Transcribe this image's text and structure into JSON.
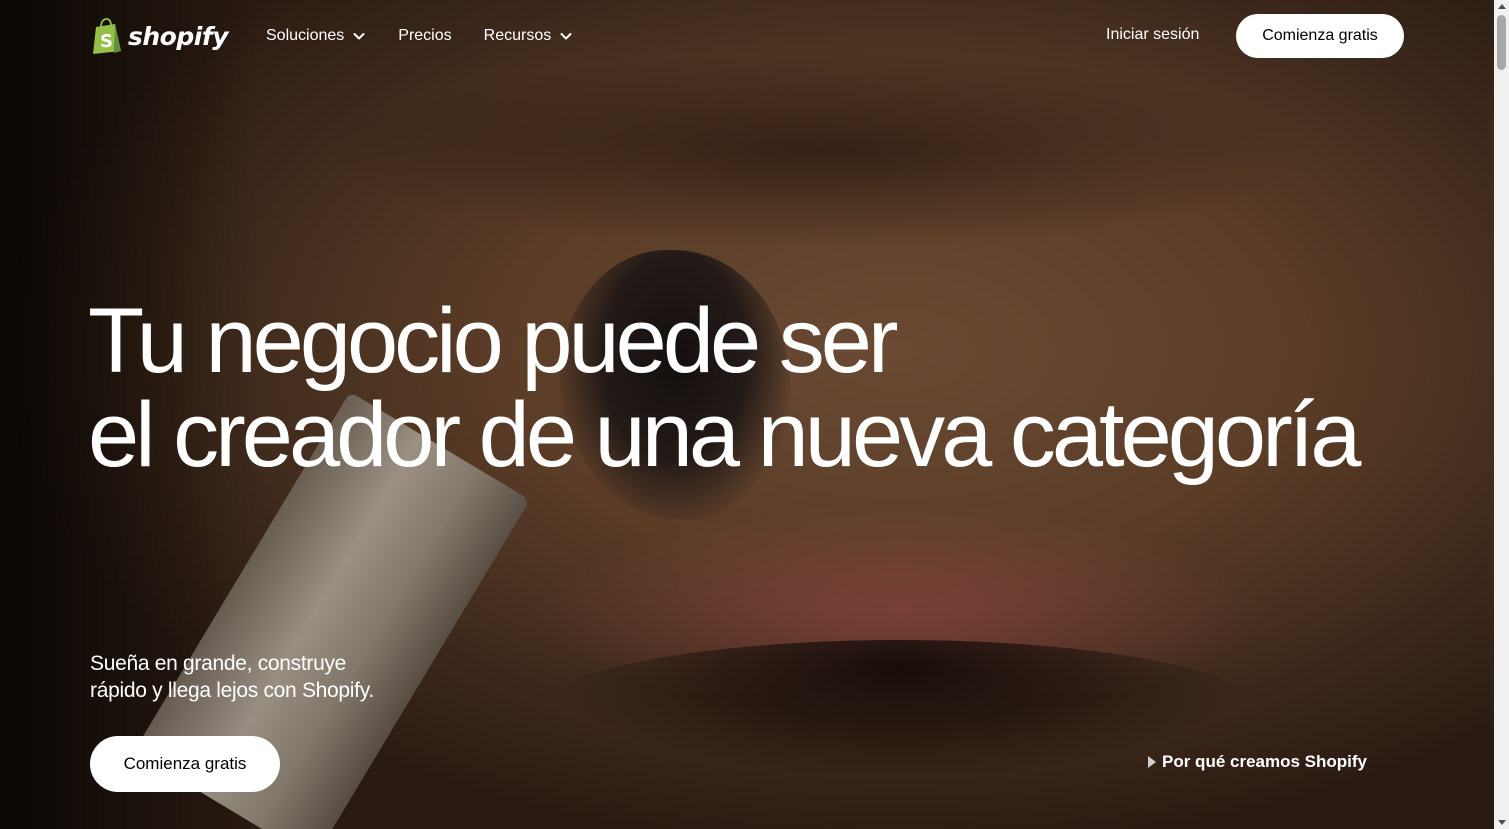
{
  "header": {
    "logo_text": "shopify",
    "nav": [
      {
        "label": "Soluciones",
        "has_dropdown": true
      },
      {
        "label": "Precios",
        "has_dropdown": false
      },
      {
        "label": "Recursos",
        "has_dropdown": true
      }
    ],
    "login_label": "Iniciar sesión",
    "cta_label": "Comienza gratis"
  },
  "hero": {
    "headline_line1": "Tu negocio puede ser",
    "headline_line2": "el creador de una nueva categoría",
    "subtext_line1": "Sueña en grande, construye",
    "subtext_line2": "rápido y llega lejos con Shopify.",
    "cta_label": "Comienza gratis",
    "video_link_label": "Por qué creamos Shopify"
  },
  "icons": {
    "logo": "shopping-bag-icon",
    "dropdown": "chevron-down-icon",
    "video": "play-icon"
  },
  "colors": {
    "brand_green": "#95BF47",
    "brand_green_dark": "#5E8E3E",
    "text": "#FFFFFF",
    "button_bg": "#FFFFFF",
    "button_text": "#000000"
  }
}
